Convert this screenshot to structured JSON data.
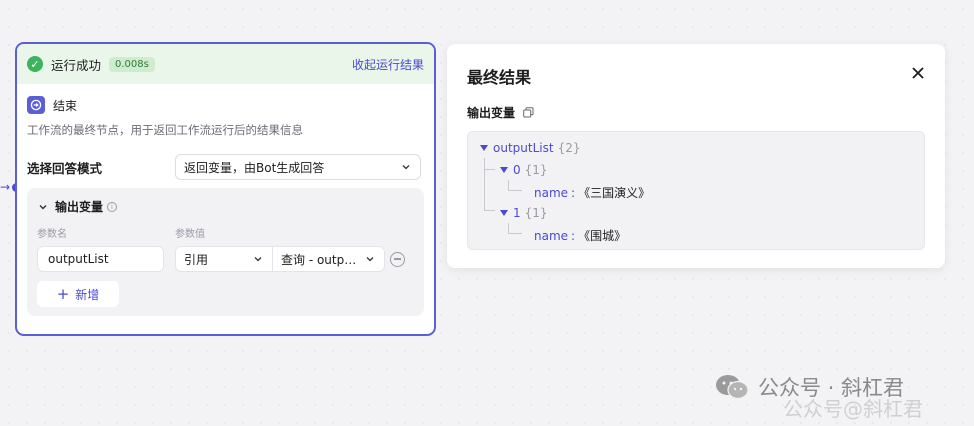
{
  "node": {
    "run_status": "运行成功",
    "run_time": "0.008s",
    "collapse_label": "收起运行结果",
    "title": "结束",
    "description": "工作流的最终节点，用于返回工作流运行后的结果信息",
    "mode_label": "选择回答模式",
    "mode_value": "返回变量，由Bot生成回答",
    "output_section_title": "输出变量",
    "col_name": "参数名",
    "col_value": "参数值",
    "param_name": "outputList",
    "ref_type": "引用",
    "ref_value": "查询 - outpu...",
    "add_label": "新增"
  },
  "result": {
    "title": "最终结果",
    "var_label": "输出变量",
    "tree": {
      "root_key": "outputList",
      "root_count": "{2}",
      "items": [
        {
          "index": "0",
          "count": "{1}",
          "field": "name",
          "value": "《三国演义》"
        },
        {
          "index": "1",
          "count": "{1}",
          "field": "name",
          "value": "《围城》"
        }
      ]
    }
  },
  "watermark": {
    "main": "公众号 · 斜杠君",
    "sub": "公众号@斜杠君"
  },
  "colors": {
    "accent": "#4b49d1",
    "success": "#3eb35e",
    "node_border": "#5b5fd6"
  }
}
